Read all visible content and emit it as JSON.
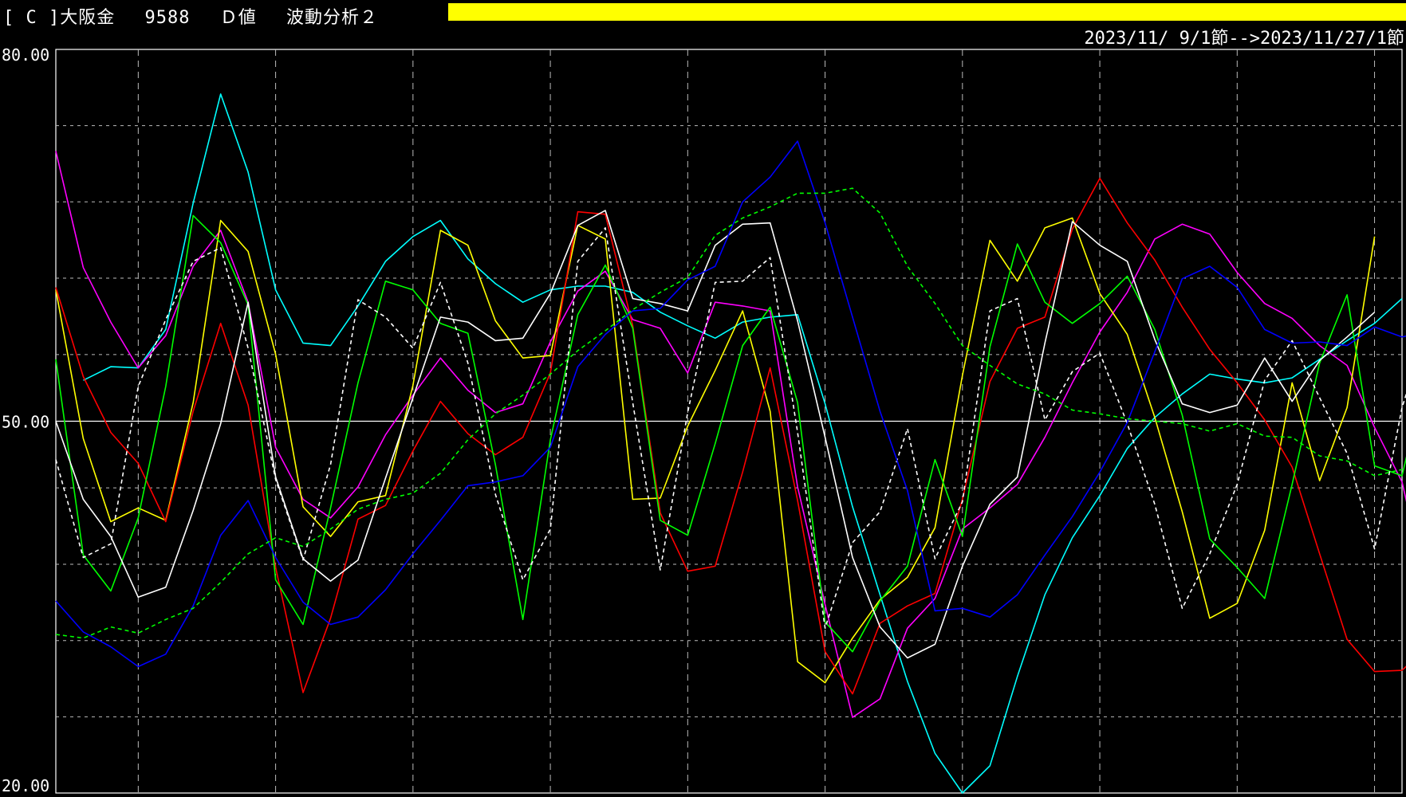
{
  "header": {
    "title": "[ C ]大阪金　 9588 　Ｄ値　 波動分析２",
    "date_range": "2023/11/ 9/1節-->2023/11/27/1節",
    "progress_color": "#ffff00",
    "progress": 1.0
  },
  "chart_data": {
    "type": "line",
    "ylim": [
      20,
      80
    ],
    "yticks": [
      {
        "value": 80,
        "label": "80.00"
      },
      {
        "value": 50,
        "label": "50.00"
      },
      {
        "value": 20,
        "label": "20.00"
      }
    ],
    "y_gridlines": [
      73.85,
      67.7,
      61.54,
      55.38,
      44.62,
      38.46,
      32.3,
      26.15
    ],
    "x_count": 50,
    "x_gridlines": [
      3,
      8,
      13,
      18,
      23,
      28,
      33,
      38,
      43,
      48
    ],
    "grid": true,
    "baseline": 50,
    "series": [
      {
        "color": "#00ffff",
        "dashed": false,
        "values": [
          null,
          53.3,
          54.4,
          54.3,
          57.4,
          67.6,
          76.4,
          70.1,
          60.6,
          56.3,
          56.1,
          59.3,
          62.9,
          64.9,
          66.2,
          63.1,
          61.1,
          59.6,
          60.6,
          60.9,
          60.9,
          60.4,
          58.8,
          57.7,
          56.7,
          58.0,
          58.4,
          58.6,
          51.4,
          43.1,
          36.0,
          29.0,
          23.2,
          20.0,
          22.2,
          29.4,
          36.0,
          40.6,
          44.0,
          47.8,
          50.3,
          52.2,
          53.8,
          53.4,
          53.1,
          53.5,
          55.0,
          56.5,
          57.9,
          59.9
        ]
      },
      {
        "color": "#ff00ff",
        "dashed": false,
        "values": [
          71.8,
          62.4,
          58.0,
          54.3,
          56.9,
          62.5,
          65.4,
          59.6,
          47.9,
          43.7,
          42.2,
          44.7,
          48.9,
          52.1,
          55.1,
          52.5,
          50.7,
          51.4,
          56.4,
          60.5,
          62.1,
          58.2,
          57.5,
          53.9,
          59.6,
          59.3,
          58.9,
          44.7,
          35.2,
          26.1,
          27.6,
          33.3,
          35.7,
          41.3,
          43.0,
          44.9,
          48.7,
          53.1,
          57.2,
          60.4,
          64.7,
          65.9,
          65.1,
          62.0,
          59.5,
          58.3,
          56.1,
          54.5,
          49.5,
          45.1,
          35.5
        ]
      },
      {
        "color": "#ffff00",
        "dashed": false,
        "values": [
          60.6,
          48.6,
          41.9,
          43.0,
          42.0,
          51.5,
          66.2,
          63.7,
          55.4,
          43.1,
          40.7,
          43.5,
          44.0,
          52.9,
          65.4,
          64.2,
          58.1,
          55.1,
          55.3,
          65.8,
          64.7,
          43.7,
          43.8,
          49.6,
          54.1,
          58.9,
          50.8,
          30.6,
          28.9,
          32.5,
          35.6,
          37.4,
          41.4,
          53.7,
          64.6,
          61.3,
          65.6,
          66.4,
          60.3,
          57.0,
          50.3,
          42.7,
          34.1,
          35.3,
          41.2,
          53.1,
          45.2,
          51.1,
          64.9
        ]
      },
      {
        "color": "#ff0000",
        "dashed": false,
        "values": [
          60.8,
          53.6,
          49.1,
          46.6,
          41.9,
          50.8,
          57.9,
          51.3,
          38.2,
          28.1,
          34.1,
          42.1,
          43.2,
          47.6,
          51.6,
          49.0,
          47.3,
          48.7,
          53.9,
          66.9,
          66.7,
          57.7,
          42.6,
          37.9,
          38.3,
          45.9,
          54.3,
          43.6,
          31.4,
          28.0,
          33.7,
          35.1,
          36.1,
          43.7,
          53.2,
          57.5,
          58.4,
          65.5,
          69.6,
          66.0,
          63.0,
          59.2,
          55.8,
          53.1,
          50.1,
          46.3,
          39.3,
          32.4,
          29.8,
          29.9,
          32.0
        ]
      },
      {
        "color": "#00ff00",
        "dashed": false,
        "values": [
          55.0,
          39.2,
          36.3,
          42.2,
          52.8,
          66.6,
          64.4,
          59.4,
          37.2,
          33.6,
          43.0,
          53.1,
          61.3,
          60.6,
          57.9,
          57.1,
          46.5,
          34.0,
          48.5,
          58.6,
          62.6,
          57.5,
          42.0,
          40.8,
          48.2,
          56.1,
          59.2,
          51.5,
          33.8,
          31.4,
          35.5,
          38.3,
          46.9,
          40.7,
          56.0,
          64.3,
          59.6,
          57.9,
          59.5,
          61.7,
          57.4,
          50.5,
          40.5,
          38.2,
          35.7,
          44.9,
          54.7,
          60.2,
          46.4,
          45.6,
          54.9
        ]
      },
      {
        "color": "#ffffff",
        "dashed": false,
        "values": [
          50.0,
          43.7,
          40.7,
          35.8,
          36.6,
          42.8,
          49.8,
          59.6,
          45.5,
          38.9,
          37.1,
          38.8,
          45.4,
          51.9,
          58.4,
          58.0,
          56.5,
          56.7,
          60.3,
          65.8,
          67.0,
          59.9,
          59.5,
          58.9,
          64.2,
          65.9,
          66.0,
          58.1,
          48.7,
          39.0,
          33.4,
          30.9,
          32.0,
          38.3,
          43.3,
          45.5,
          56.3,
          66.1,
          64.2,
          62.9,
          56.6,
          51.4,
          50.7,
          51.3,
          55.1,
          51.6,
          54.9,
          56.8,
          58.8
        ]
      },
      {
        "color": "#ffffff",
        "dashed": true,
        "values": [
          46.9,
          39.0,
          40.1,
          52.8,
          58.2,
          62.9,
          64.0,
          55.9,
          45.3,
          38.8,
          46.5,
          59.8,
          58.4,
          55.9,
          61.2,
          54.7,
          44.1,
          37.2,
          41.3,
          62.9,
          65.6,
          51.5,
          38.0,
          50.7,
          61.2,
          61.3,
          63.2,
          49.1,
          33.3,
          40.2,
          42.7,
          49.4,
          38.9,
          43.5,
          58.9,
          59.9,
          50.1,
          54.0,
          55.5,
          49.8,
          43.3,
          34.9,
          39.3,
          44.9,
          53.3,
          56.5,
          51.9,
          47.4,
          39.7,
          51.1,
          58.1
        ]
      },
      {
        "color": "#0000ff",
        "dashed": false,
        "values": [
          35.5,
          33.0,
          31.8,
          30.2,
          31.2,
          35.1,
          40.8,
          43.6,
          39.0,
          35.4,
          33.6,
          34.2,
          36.4,
          39.3,
          42.0,
          44.8,
          45.1,
          45.6,
          47.9,
          54.4,
          57.0,
          58.9,
          59.1,
          61.4,
          62.5,
          67.7,
          69.7,
          72.6,
          66.0,
          58.4,
          50.8,
          44.4,
          34.7,
          34.9,
          34.2,
          36.0,
          39.2,
          42.3,
          45.9,
          49.9,
          55.6,
          61.5,
          62.5,
          60.8,
          57.4,
          56.3,
          56.4,
          56.1,
          57.6,
          56.8,
          57.3
        ]
      },
      {
        "color": "#00ff00",
        "dashed": true,
        "values": [
          32.8,
          32.5,
          33.4,
          32.9,
          34.0,
          34.9,
          37.0,
          39.3,
          40.6,
          39.9,
          41.3,
          42.9,
          43.7,
          44.2,
          45.8,
          48.5,
          50.6,
          52.1,
          53.8,
          55.7,
          57.3,
          59.0,
          60.4,
          61.6,
          65.0,
          66.4,
          67.3,
          68.4,
          68.4,
          68.8,
          66.8,
          62.5,
          59.5,
          56.1,
          54.5,
          53.0,
          52.2,
          50.9,
          50.6,
          50.2,
          50.0,
          49.8,
          49.2,
          49.8,
          48.8,
          48.7,
          47.2,
          46.8,
          45.6,
          46.1
        ]
      }
    ]
  }
}
